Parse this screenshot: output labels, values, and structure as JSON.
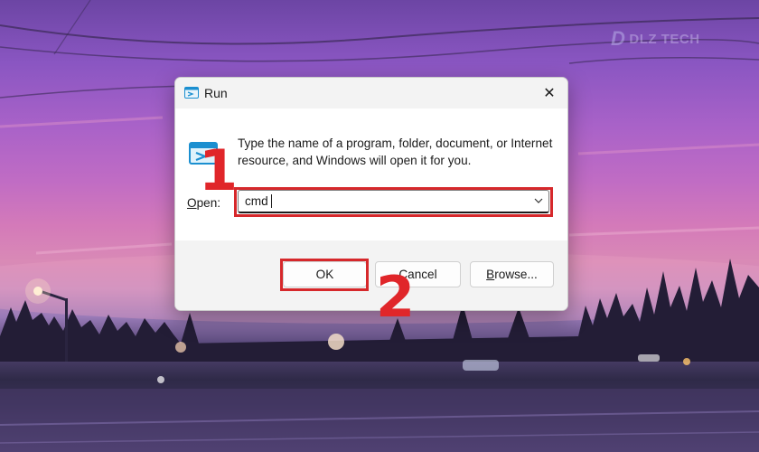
{
  "wallpaper": {
    "watermark_text": "DLZ TECH",
    "watermark_mark": "D"
  },
  "dialog": {
    "title": "Run",
    "close_glyph": "✕",
    "title_icon": "run-icon",
    "description": "Type the name of a program, folder, document, or Internet resource, and Windows will open it for you.",
    "open_label_mnemonic": "O",
    "open_label_rest": "pen:",
    "open_value": "cmd",
    "dropdown_icon": "chevron-down-icon",
    "buttons": {
      "ok": "OK",
      "cancel_mnemonic": "",
      "cancel_rest": "Cancel",
      "browse_mnemonic": "B",
      "browse_rest": "rowse..."
    }
  },
  "annotations": {
    "step1": "1",
    "step2": "2",
    "color": "#d6282b"
  },
  "colors": {
    "accent": "#0067c0",
    "dialog_bg": "#ffffff",
    "footer_bg": "#f3f3f3"
  }
}
